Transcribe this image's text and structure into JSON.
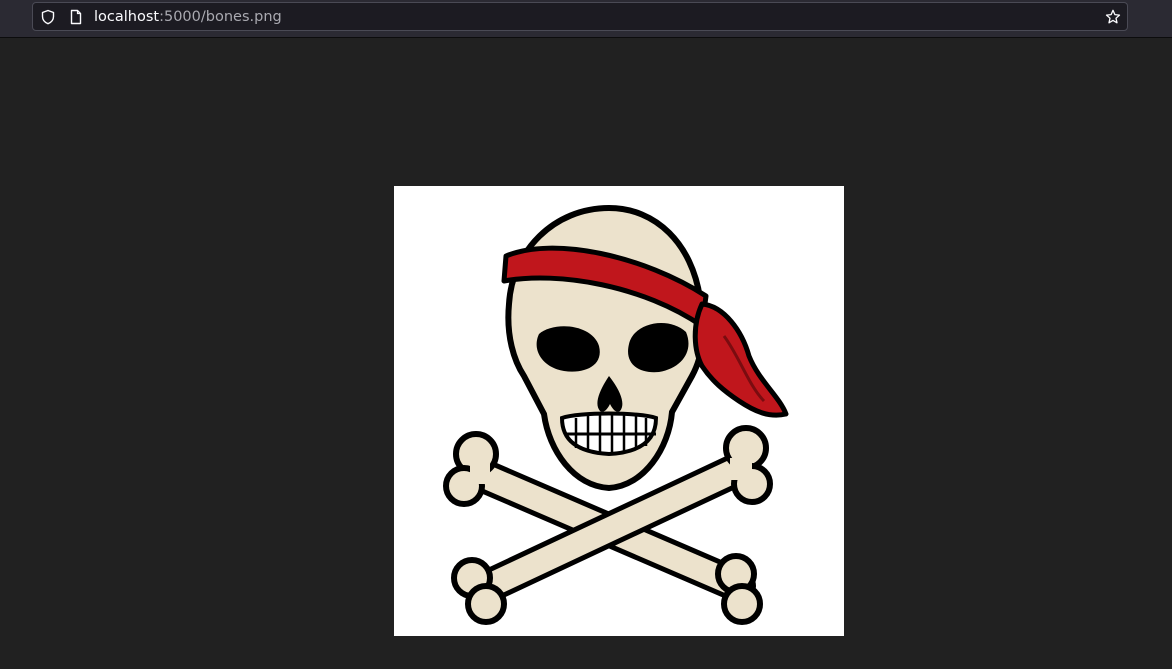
{
  "browser": {
    "url_host": "localhost",
    "url_rest": ":5000/bones.png",
    "icons": {
      "left": [
        "shield-icon",
        "page-icon"
      ],
      "right": "star-icon"
    }
  },
  "image": {
    "subject": "skull-and-crossbones",
    "colors": {
      "bandana": "#c0161c",
      "bone": "#ece2cc",
      "outline": "#000000",
      "background": "#ffffff"
    }
  }
}
